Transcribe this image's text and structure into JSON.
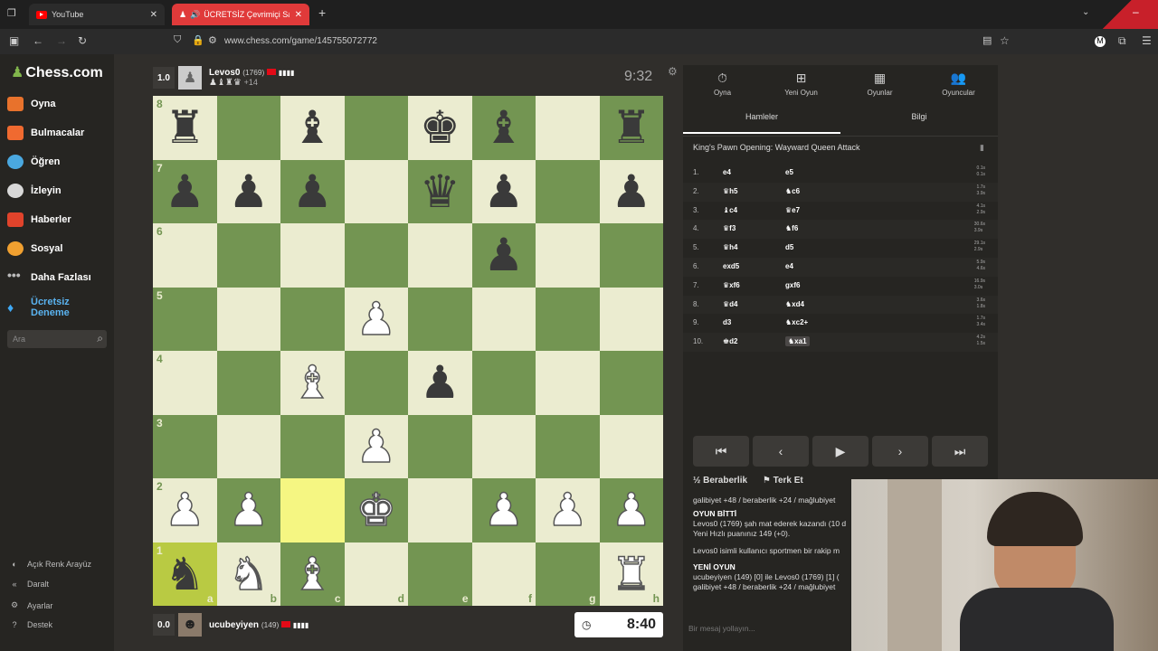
{
  "browser": {
    "tabs": [
      {
        "title": "YouTube",
        "active": false
      },
      {
        "title": "ÜCRETSİZ Çevrimiçi Satranç",
        "active": true
      }
    ],
    "url": "www.chess.com/game/145755072772"
  },
  "sidebar": {
    "logo": "Chess.com",
    "items": [
      {
        "label": "Oyna",
        "icon": "play-icon",
        "color": "#e8722c"
      },
      {
        "label": "Bulmacalar",
        "icon": "puzzle-icon",
        "color": "#f06a30"
      },
      {
        "label": "Öğren",
        "icon": "learn-icon",
        "color": "#4aa8e0"
      },
      {
        "label": "İzleyin",
        "icon": "watch-icon",
        "color": "#d8d8d8"
      },
      {
        "label": "Haberler",
        "icon": "news-icon",
        "color": "#e0432b"
      },
      {
        "label": "Sosyal",
        "icon": "social-icon",
        "color": "#f0a030"
      },
      {
        "label": "Daha Fazlası",
        "icon": "more-icon",
        "color": "#bbbbbb"
      }
    ],
    "trial": "Ücretsiz Deneme",
    "search_placeholder": "Ara",
    "bottom": [
      {
        "label": "Açık Renk Arayüz",
        "icon": "theme-icon"
      },
      {
        "label": "Daralt",
        "icon": "collapse-icon"
      },
      {
        "label": "Ayarlar",
        "icon": "settings-icon"
      },
      {
        "label": "Destek",
        "icon": "help-icon"
      }
    ]
  },
  "top_player": {
    "score": "1.0",
    "name": "Levos0",
    "rating": "(1769)",
    "captured": "♟♝♜♛",
    "advantage": "+14",
    "clock": "9:32"
  },
  "bottom_player": {
    "score": "0.0",
    "name": "ucubeyiyen",
    "rating": "(149)",
    "clock": "8:40"
  },
  "board": {
    "files": [
      "a",
      "b",
      "c",
      "d",
      "e",
      "f",
      "g",
      "h"
    ],
    "ranks": [
      "8",
      "7",
      "6",
      "5",
      "4",
      "3",
      "2",
      "1"
    ],
    "position": [
      [
        "br",
        "",
        "bb",
        "",
        "bk",
        "bb",
        "",
        "br"
      ],
      [
        "bp",
        "bp",
        "bp",
        "",
        "bq",
        "bp",
        "",
        "bp"
      ],
      [
        "",
        "",
        "",
        "",
        "",
        "bp",
        "",
        ""
      ],
      [
        "",
        "",
        "",
        "wp",
        "",
        "",
        "",
        ""
      ],
      [
        "",
        "",
        "wb",
        "",
        "bp",
        "",
        "",
        ""
      ],
      [
        "",
        "",
        "",
        "wp",
        "",
        "",
        "",
        ""
      ],
      [
        "wp",
        "wp",
        "",
        "wk",
        "",
        "wp",
        "wp",
        "wp"
      ],
      [
        "bn",
        "wn",
        "wb",
        "",
        "",
        "",
        "",
        "wr"
      ]
    ],
    "highlight": [
      "a1",
      "c2"
    ],
    "light_color": "#ebecd0",
    "dark_color": "#739552"
  },
  "right_panel": {
    "tabs": [
      {
        "label": "Oyna",
        "icon": "play-clock-icon"
      },
      {
        "label": "Yeni Oyun",
        "icon": "plus-icon"
      },
      {
        "label": "Oyunlar",
        "icon": "games-icon"
      },
      {
        "label": "Oyuncular",
        "icon": "players-icon"
      }
    ],
    "subtabs": [
      "Hamleler",
      "Bilgi"
    ],
    "opening": "King's Pawn Opening: Wayward Queen Attack",
    "moves": [
      {
        "n": "1.",
        "w": "e4",
        "b": "e5",
        "t": [
          "0.1s",
          "0.1s"
        ]
      },
      {
        "n": "2.",
        "w": "♛h5",
        "b": "♞c6",
        "t": [
          "1.7s",
          "3.9s"
        ]
      },
      {
        "n": "3.",
        "w": "♝c4",
        "b": "♛e7",
        "t": [
          "4.1s",
          "2.9s"
        ]
      },
      {
        "n": "4.",
        "w": "♛f3",
        "b": "♞f6",
        "t": [
          "30.6s",
          "3.9s"
        ]
      },
      {
        "n": "5.",
        "w": "♛h4",
        "b": "d5",
        "t": [
          "29.1s",
          "2.9s"
        ]
      },
      {
        "n": "6.",
        "w": "exd5",
        "b": "e4",
        "t": [
          "5.9s",
          "4.6s"
        ]
      },
      {
        "n": "7.",
        "w": "♛xf6",
        "b": "gxf6",
        "t": [
          "16.9s",
          "3.0s"
        ]
      },
      {
        "n": "8.",
        "w": "♛d4",
        "b": "♞xd4",
        "t": [
          "3.6s",
          "1.8s"
        ]
      },
      {
        "n": "9.",
        "w": "d3",
        "b": "♞xc2+",
        "t": [
          "1.7s",
          "3.4s"
        ]
      },
      {
        "n": "10.",
        "w": "♚d2",
        "b": "♞xa1",
        "t": [
          "4.2s",
          "1.5s"
        ]
      }
    ],
    "draw": "Beraberlik",
    "resign": "Terk Et",
    "chat": [
      "galibiyet +48 / beraberlik +24 / mağlubiyet",
      "OYUN BİTTİ",
      "Levos0 (1769) şah mat ederek kazandı (10 d",
      "Yeni Hızlı puanınız 149 (+0).",
      "",
      "Levos0 isimli kullanıcı sportmen bir rakip m",
      "",
      "YENİ OYUN",
      "ucubeyiyen (149) [0] ile Levos0 (1769) [1] (",
      "galibiyet +48 / beraberlik +24 / mağlubiyet"
    ],
    "chat_placeholder": "Bir mesaj yollayın..."
  }
}
